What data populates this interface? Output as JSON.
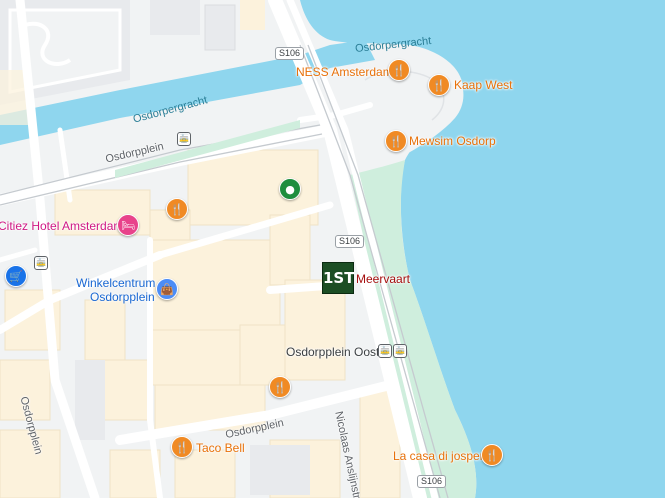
{
  "map": {
    "water_names": [
      "Osdorpergracht",
      "Osdorpergracht"
    ],
    "streets": [
      "Osdorpplein",
      "Osdorpplein",
      "Osdorpplein",
      "Nicolaas Anslijnstraat"
    ],
    "road_shields": [
      "S106",
      "S106",
      "S106"
    ],
    "pois": {
      "ness": "NESS Amsterdam",
      "kaap": "Kaap West",
      "mewsim": "Mewsim Osdorp",
      "citizen": "Citiez Hotel Amsterdam",
      "winkel_line1": "Winkelcentrum",
      "winkel_line2": "Osdorpplein",
      "meervaart": "Meervaart",
      "oost": "Osdorpplein Oost",
      "taco": "Taco Bell",
      "lacasa": "La casa di josper"
    },
    "icons": {
      "restaurant": "restaurant-icon",
      "hotel": "hotel-icon",
      "shopping": "shopping-bag-icon",
      "cart": "shopping-cart-icon",
      "place": "place-icon",
      "tram": "tram-icon"
    },
    "logo_text": "1ST",
    "colors": {
      "water": "#8fd6ee",
      "park": "#cfeedd",
      "block": "#fcf2dc",
      "road": "#ffffff",
      "poi_orange": "#e8710a",
      "poi_pink": "#d01884",
      "poi_blue": "#1967d2"
    }
  }
}
